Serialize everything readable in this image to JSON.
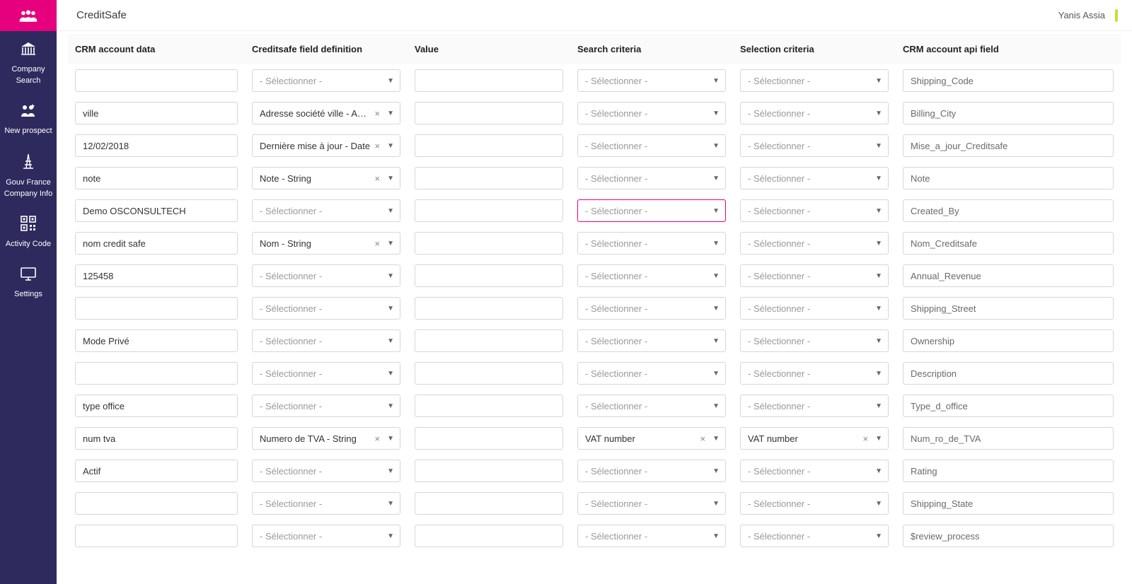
{
  "app": {
    "title": "CreditSafe",
    "user": "Yanis Assia"
  },
  "sidebar": {
    "items": [
      {
        "id": "company-search",
        "label": "Company\nSearch"
      },
      {
        "id": "new-prospect",
        "label": "New prospect"
      },
      {
        "id": "gouv-france",
        "label": "Gouv France\nCompany Info"
      },
      {
        "id": "activity-code",
        "label": "Activity Code"
      },
      {
        "id": "settings",
        "label": "Settings"
      }
    ]
  },
  "table": {
    "placeholder_select": "- Sélectionner -",
    "headers": {
      "crm": "CRM account data",
      "def": "Creditsafe field definition",
      "value": "Value",
      "search": "Search criteria",
      "select": "Selection criteria",
      "api": "CRM account api field"
    },
    "rows": [
      {
        "crm": "",
        "def": "",
        "value": "",
        "search": "",
        "select": "",
        "api": "Shipping_Code"
      },
      {
        "crm": "ville",
        "def": "Adresse société ville - Adr...",
        "value": "",
        "search": "",
        "select": "",
        "api": "Billing_City"
      },
      {
        "crm": "12/02/2018",
        "def": "Dernière mise à jour - Date",
        "value": "",
        "search": "",
        "select": "",
        "api": "Mise_a_jour_Creditsafe"
      },
      {
        "crm": "note",
        "def": "Note - String",
        "value": "",
        "search": "",
        "select": "",
        "api": "Note"
      },
      {
        "crm": "Demo OSCONSULTECH",
        "def": "",
        "value": "",
        "search": "",
        "select": "",
        "api": "Created_By",
        "highlightSearch": true
      },
      {
        "crm": "nom credit safe",
        "def": "Nom - String",
        "value": "",
        "search": "",
        "select": "",
        "api": "Nom_Creditsafe"
      },
      {
        "crm": "125458",
        "def": "",
        "value": "",
        "search": "",
        "select": "",
        "api": "Annual_Revenue"
      },
      {
        "crm": "",
        "def": "",
        "value": "",
        "search": "",
        "select": "",
        "api": "Shipping_Street"
      },
      {
        "crm": "Mode Privé",
        "def": "",
        "value": "",
        "search": "",
        "select": "",
        "api": "Ownership"
      },
      {
        "crm": "",
        "def": "",
        "value": "",
        "search": "",
        "select": "",
        "api": "Description"
      },
      {
        "crm": "type office",
        "def": "",
        "value": "",
        "search": "",
        "select": "",
        "api": "Type_d_office"
      },
      {
        "crm": "num tva",
        "def": "Numero de TVA - String",
        "value": "",
        "search": "VAT number",
        "select": "VAT number",
        "api": "Num_ro_de_TVA"
      },
      {
        "crm": "Actif",
        "def": "",
        "value": "",
        "search": "",
        "select": "",
        "api": "Rating"
      },
      {
        "crm": "",
        "def": "",
        "value": "",
        "search": "",
        "select": "",
        "api": "Shipping_State"
      },
      {
        "crm": "",
        "def": "",
        "value": "",
        "search": "",
        "select": "",
        "api": "$review_process"
      }
    ]
  }
}
